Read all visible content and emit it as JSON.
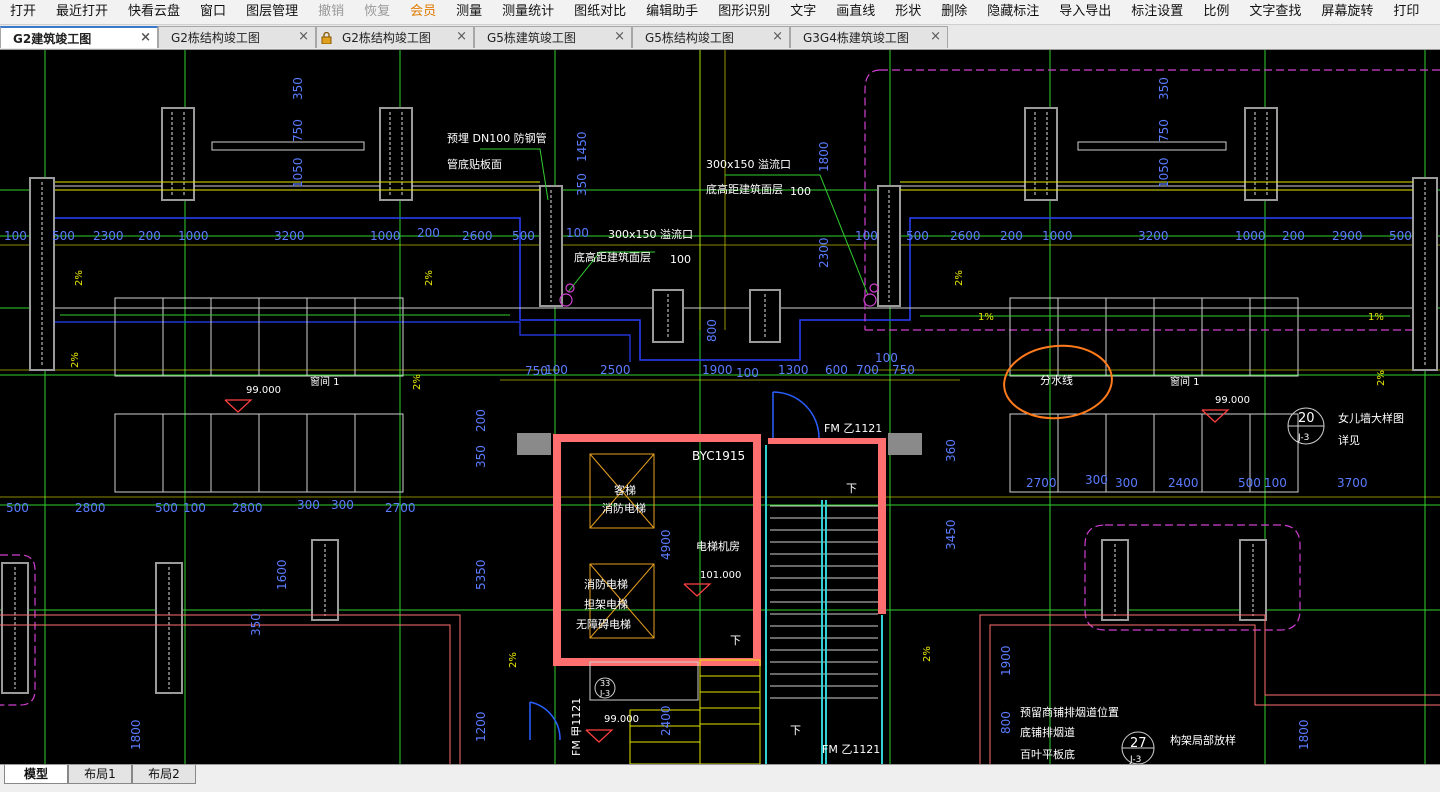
{
  "menu": [
    "打开",
    "最近打开",
    "快看云盘",
    "窗口",
    "图层管理",
    "撤销",
    "恢复",
    "会员",
    "测量",
    "测量统计",
    "图纸对比",
    "编辑助手",
    "图形识别",
    "文字",
    "画直线",
    "形状",
    "删除",
    "隐藏标注",
    "导入导出",
    "标注设置",
    "比例",
    "文字查找",
    "屏幕旋转",
    "打印"
  ],
  "tabs": [
    "G2建筑竣工图",
    "G2栋结构竣工图",
    "G2栋结构竣工图",
    "G5栋建筑竣工图",
    "G5栋结构竣工图",
    "G3G4栋建筑竣工图"
  ],
  "layout_tabs": [
    "模型",
    "布局1",
    "布局2"
  ],
  "colors": {
    "dim": "#5a7cff",
    "wall": "#8a8a8a",
    "green": "#30d030",
    "yellow": "#e6e600",
    "pink": "#ff6f6f",
    "magenta": "#d040d0",
    "cyan": "#30d0d0",
    "orange": "#ff7a1a",
    "white": "#ffffff"
  },
  "drawing": {
    "dims_top_left": [
      "100",
      "500",
      "2300",
      "200",
      "1000",
      "3200",
      "1000",
      "200",
      "2600",
      "500",
      "100"
    ],
    "dims_top_right": [
      "100",
      "500",
      "2600",
      "200",
      "1000",
      "3200",
      "1000",
      "200",
      "2900",
      "500"
    ],
    "dims_vertical": [
      "350",
      "750",
      "1050",
      "350",
      "1450",
      "1800",
      "2300",
      "350",
      "750",
      "1050"
    ],
    "dims_mid": [
      "100",
      "750",
      "2500",
      "1900",
      "100",
      "1300",
      "600",
      "700",
      "750",
      "100"
    ],
    "dims_row_left": [
      "500",
      "2800",
      "500",
      "100",
      "2800",
      "300",
      "300",
      "2700"
    ],
    "dims_row_right": [
      "2700",
      "300",
      "300",
      "2400",
      "500",
      "100",
      "3700"
    ],
    "dims_misc": [
      "200",
      "350",
      "360",
      "4900",
      "5350",
      "3450",
      "1600",
      "350",
      "1900",
      "800",
      "1200",
      "1800",
      "2400",
      "1800",
      "800"
    ],
    "labels": {
      "pipe1": "预埋 DN100  防钢管",
      "pipe2": "管底贴板面",
      "overflow1": "300x150  溢流口",
      "overflow2": "底高距建筑面层",
      "overflow_val": "100",
      "overflow3": "300x150  溢流口",
      "overflow4": "底高距建筑面层",
      "overflow_val2": "100",
      "elev1": "99.000",
      "elev2": "99.000",
      "elev3": "101.000",
      "elev4": "99.000",
      "room_tag1": "窗间 1",
      "room_tag2": "窗间 1",
      "fenshuixian": "分水线",
      "byc": "BYC1915",
      "fm1": "FM 乙1121",
      "fm2": "FM 乙1121",
      "fm3": "FM 甲1121",
      "elevator1": "客梯",
      "elevator1b": "消防电梯",
      "elevator2": "消防电梯",
      "elevator2b": "担架电梯",
      "elevator2c": "无障碍电梯",
      "machine_room": "电梯机房",
      "down1": "下",
      "down2": "下",
      "down3": "下",
      "parapet_no": "20",
      "parapet_ref": "J-3",
      "parapet1": "女儿墙大样图",
      "parapet2": "详见",
      "flue1": "预留商铺排烟道位置",
      "flue2": "底铺排烟道",
      "flue3": "百叶平板底",
      "detail_no": "27",
      "detail_ref": "J-3",
      "detail_text": "构架局部放样",
      "slope1": "1%",
      "slope2": "1%",
      "slope": "2%",
      "small_no": "33",
      "small_ref": "J-3"
    }
  }
}
